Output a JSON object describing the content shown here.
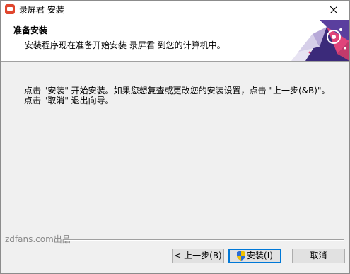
{
  "window": {
    "title": "录屏君 安装"
  },
  "header": {
    "title": "准备安装",
    "subtitle": "安装程序现在准备开始安装 录屏君 到您的计算机中。"
  },
  "body": {
    "line1": "点击 \"安装\" 开始安装。如果您想复查或更改您的安装设置，点击 \"上一步(&B)\"。",
    "line2": "点击 \"取消\" 退出向导。"
  },
  "footer": {
    "brand": "zdfans.com出品"
  },
  "buttons": {
    "back_label": "< 上一步(B)",
    "install_label": "安装(I)",
    "cancel_label": "取消"
  },
  "icons": {
    "app": "app-icon",
    "close": "close-icon",
    "shield": "uac-shield-icon"
  },
  "colors": {
    "focus_border": "#0078d7",
    "app_icon": "#e0462e",
    "header_graphic_dark": "#3b2a7a",
    "header_graphic_pink": "#e0447a"
  }
}
